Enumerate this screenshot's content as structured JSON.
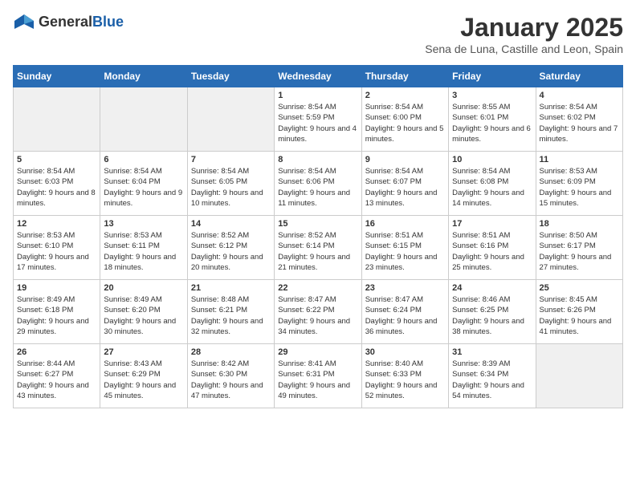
{
  "header": {
    "logo": {
      "general": "General",
      "blue": "Blue"
    },
    "title": "January 2025",
    "location": "Sena de Luna, Castille and Leon, Spain"
  },
  "weekdays": [
    "Sunday",
    "Monday",
    "Tuesday",
    "Wednesday",
    "Thursday",
    "Friday",
    "Saturday"
  ],
  "weeks": [
    [
      {
        "day": "",
        "sunrise": "",
        "sunset": "",
        "daylight": "",
        "empty": true
      },
      {
        "day": "",
        "sunrise": "",
        "sunset": "",
        "daylight": "",
        "empty": true
      },
      {
        "day": "",
        "sunrise": "",
        "sunset": "",
        "daylight": "",
        "empty": true
      },
      {
        "day": "1",
        "sunrise": "Sunrise: 8:54 AM",
        "sunset": "Sunset: 5:59 PM",
        "daylight": "Daylight: 9 hours and 4 minutes."
      },
      {
        "day": "2",
        "sunrise": "Sunrise: 8:54 AM",
        "sunset": "Sunset: 6:00 PM",
        "daylight": "Daylight: 9 hours and 5 minutes."
      },
      {
        "day": "3",
        "sunrise": "Sunrise: 8:55 AM",
        "sunset": "Sunset: 6:01 PM",
        "daylight": "Daylight: 9 hours and 6 minutes."
      },
      {
        "day": "4",
        "sunrise": "Sunrise: 8:54 AM",
        "sunset": "Sunset: 6:02 PM",
        "daylight": "Daylight: 9 hours and 7 minutes."
      }
    ],
    [
      {
        "day": "5",
        "sunrise": "Sunrise: 8:54 AM",
        "sunset": "Sunset: 6:03 PM",
        "daylight": "Daylight: 9 hours and 8 minutes."
      },
      {
        "day": "6",
        "sunrise": "Sunrise: 8:54 AM",
        "sunset": "Sunset: 6:04 PM",
        "daylight": "Daylight: 9 hours and 9 minutes."
      },
      {
        "day": "7",
        "sunrise": "Sunrise: 8:54 AM",
        "sunset": "Sunset: 6:05 PM",
        "daylight": "Daylight: 9 hours and 10 minutes."
      },
      {
        "day": "8",
        "sunrise": "Sunrise: 8:54 AM",
        "sunset": "Sunset: 6:06 PM",
        "daylight": "Daylight: 9 hours and 11 minutes."
      },
      {
        "day": "9",
        "sunrise": "Sunrise: 8:54 AM",
        "sunset": "Sunset: 6:07 PM",
        "daylight": "Daylight: 9 hours and 13 minutes."
      },
      {
        "day": "10",
        "sunrise": "Sunrise: 8:54 AM",
        "sunset": "Sunset: 6:08 PM",
        "daylight": "Daylight: 9 hours and 14 minutes."
      },
      {
        "day": "11",
        "sunrise": "Sunrise: 8:53 AM",
        "sunset": "Sunset: 6:09 PM",
        "daylight": "Daylight: 9 hours and 15 minutes."
      }
    ],
    [
      {
        "day": "12",
        "sunrise": "Sunrise: 8:53 AM",
        "sunset": "Sunset: 6:10 PM",
        "daylight": "Daylight: 9 hours and 17 minutes."
      },
      {
        "day": "13",
        "sunrise": "Sunrise: 8:53 AM",
        "sunset": "Sunset: 6:11 PM",
        "daylight": "Daylight: 9 hours and 18 minutes."
      },
      {
        "day": "14",
        "sunrise": "Sunrise: 8:52 AM",
        "sunset": "Sunset: 6:12 PM",
        "daylight": "Daylight: 9 hours and 20 minutes."
      },
      {
        "day": "15",
        "sunrise": "Sunrise: 8:52 AM",
        "sunset": "Sunset: 6:14 PM",
        "daylight": "Daylight: 9 hours and 21 minutes."
      },
      {
        "day": "16",
        "sunrise": "Sunrise: 8:51 AM",
        "sunset": "Sunset: 6:15 PM",
        "daylight": "Daylight: 9 hours and 23 minutes."
      },
      {
        "day": "17",
        "sunrise": "Sunrise: 8:51 AM",
        "sunset": "Sunset: 6:16 PM",
        "daylight": "Daylight: 9 hours and 25 minutes."
      },
      {
        "day": "18",
        "sunrise": "Sunrise: 8:50 AM",
        "sunset": "Sunset: 6:17 PM",
        "daylight": "Daylight: 9 hours and 27 minutes."
      }
    ],
    [
      {
        "day": "19",
        "sunrise": "Sunrise: 8:49 AM",
        "sunset": "Sunset: 6:18 PM",
        "daylight": "Daylight: 9 hours and 29 minutes."
      },
      {
        "day": "20",
        "sunrise": "Sunrise: 8:49 AM",
        "sunset": "Sunset: 6:20 PM",
        "daylight": "Daylight: 9 hours and 30 minutes."
      },
      {
        "day": "21",
        "sunrise": "Sunrise: 8:48 AM",
        "sunset": "Sunset: 6:21 PM",
        "daylight": "Daylight: 9 hours and 32 minutes."
      },
      {
        "day": "22",
        "sunrise": "Sunrise: 8:47 AM",
        "sunset": "Sunset: 6:22 PM",
        "daylight": "Daylight: 9 hours and 34 minutes."
      },
      {
        "day": "23",
        "sunrise": "Sunrise: 8:47 AM",
        "sunset": "Sunset: 6:24 PM",
        "daylight": "Daylight: 9 hours and 36 minutes."
      },
      {
        "day": "24",
        "sunrise": "Sunrise: 8:46 AM",
        "sunset": "Sunset: 6:25 PM",
        "daylight": "Daylight: 9 hours and 38 minutes."
      },
      {
        "day": "25",
        "sunrise": "Sunrise: 8:45 AM",
        "sunset": "Sunset: 6:26 PM",
        "daylight": "Daylight: 9 hours and 41 minutes."
      }
    ],
    [
      {
        "day": "26",
        "sunrise": "Sunrise: 8:44 AM",
        "sunset": "Sunset: 6:27 PM",
        "daylight": "Daylight: 9 hours and 43 minutes."
      },
      {
        "day": "27",
        "sunrise": "Sunrise: 8:43 AM",
        "sunset": "Sunset: 6:29 PM",
        "daylight": "Daylight: 9 hours and 45 minutes."
      },
      {
        "day": "28",
        "sunrise": "Sunrise: 8:42 AM",
        "sunset": "Sunset: 6:30 PM",
        "daylight": "Daylight: 9 hours and 47 minutes."
      },
      {
        "day": "29",
        "sunrise": "Sunrise: 8:41 AM",
        "sunset": "Sunset: 6:31 PM",
        "daylight": "Daylight: 9 hours and 49 minutes."
      },
      {
        "day": "30",
        "sunrise": "Sunrise: 8:40 AM",
        "sunset": "Sunset: 6:33 PM",
        "daylight": "Daylight: 9 hours and 52 minutes."
      },
      {
        "day": "31",
        "sunrise": "Sunrise: 8:39 AM",
        "sunset": "Sunset: 6:34 PM",
        "daylight": "Daylight: 9 hours and 54 minutes."
      },
      {
        "day": "",
        "sunrise": "",
        "sunset": "",
        "daylight": "",
        "empty": true
      }
    ]
  ]
}
